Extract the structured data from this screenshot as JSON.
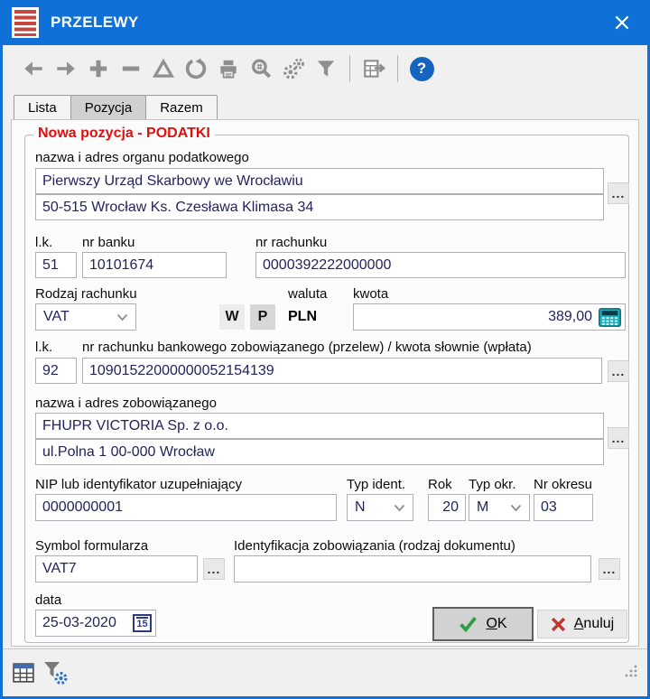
{
  "window": {
    "title": "PRZELEWY"
  },
  "toolbar": {
    "icons": [
      "back-icon",
      "forward-icon",
      "add-icon",
      "remove-icon",
      "edit-icon",
      "refresh-icon",
      "print-icon",
      "search-icon",
      "settings-icon",
      "filter-icon",
      "table-export-icon",
      "help-icon"
    ],
    "help_glyph": "?"
  },
  "tabs": {
    "items": [
      {
        "label": "Lista"
      },
      {
        "label": "Pozycja"
      },
      {
        "label": "Razem"
      }
    ],
    "active": "Pozycja"
  },
  "form": {
    "group_title": "Nowa pozycja - PODATKI",
    "ellipsis": "...",
    "organ": {
      "label": "nazwa i adres organu podatkowego",
      "name": "Pierwszy Urząd Skarbowy we Wrocławiu",
      "address": "50-515 Wrocław Ks. Czesława Klimasa 34"
    },
    "bank": {
      "lk_label": "l.k.",
      "lk": "51",
      "nr_banku_label": "nr banku",
      "nr_banku": "10101674",
      "nr_rachunku_label": "nr rachunku",
      "nr_rachunku": "0000392222000000"
    },
    "account_type": {
      "label": "Rodzaj rachunku",
      "value": "VAT",
      "w": "W",
      "p": "P",
      "waluta_label": "waluta",
      "waluta": "PLN",
      "kwota_label": "kwota",
      "kwota": "389,00"
    },
    "obligor_account": {
      "lk_label": "l.k.",
      "lk": "92",
      "label": "nr rachunku bankowego zobowiązanego (przelew) / kwota słownie (wpłata)",
      "value": "10901522000000052154139"
    },
    "obligor": {
      "label": "nazwa i adres zobowiązanego",
      "name": "FHUPR VICTORIA Sp. z o.o.",
      "address": "ul.Polna 1 00-000 Wrocław"
    },
    "ident": {
      "nip_label": "NIP lub identyfikator uzupełniający",
      "nip": "0000000001",
      "typ_ident_label": "Typ ident.",
      "typ_ident": "N",
      "rok_label": "Rok",
      "rok": "20",
      "typ_okr_label": "Typ okr.",
      "typ_okr": "M",
      "nr_okresu_label": "Nr okresu",
      "nr_okresu": "03"
    },
    "form_symbol": {
      "label": "Symbol formularza",
      "value": "VAT7"
    },
    "obligation_id": {
      "label": "Identyfikacja zobowiązania (rodzaj dokumentu)",
      "value": ""
    },
    "date": {
      "label": "data",
      "value": "25-03-2020",
      "calendar_glyph": "15"
    },
    "buttons": {
      "ok_accel": "O",
      "ok_rest": "K",
      "cancel_accel": "A",
      "cancel_rest": "nuluj"
    }
  },
  "colors": {
    "titlebar_blue": "#0f70d7",
    "toolbar_gray_icon": "#8f8f8f",
    "help_blue": "#1565c0",
    "group_title_red": "#e10e0e",
    "ok_check_green": "#2f9e43",
    "cancel_x_red": "#c5352c",
    "calculator_teal": "#17b3c0",
    "input_text_navy": "#23235e"
  }
}
